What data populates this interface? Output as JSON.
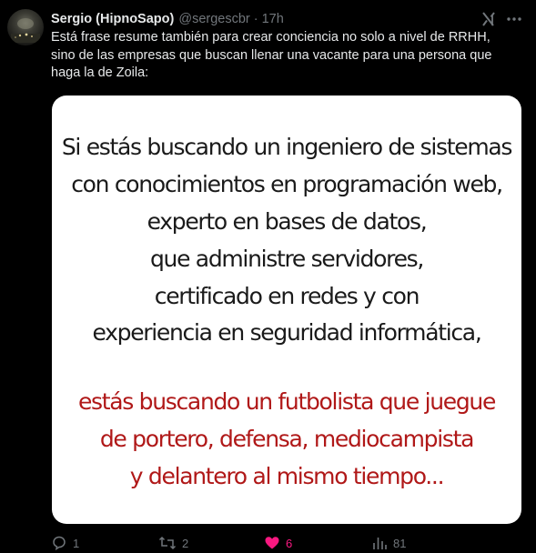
{
  "tweet": {
    "author_name": "Sergio (HipnoSapo)",
    "author_handle": "@sergescbr",
    "separator": "·",
    "timestamp": "17h",
    "text_lines": [
      "Está frase resume también para crear conciencia no solo a nivel de RRHH,",
      "sino de las empresas que buscan llenar una vacante para una persona que",
      "haga la de Zoila:"
    ],
    "image_text": {
      "black_lines": [
        "Si estás buscando un ingeniero de sistemas",
        "con conocimientos en programación web,",
        "experto en bases de datos,",
        "que administre servidores,",
        "certificado en redes y con",
        "experiencia en seguridad informática,"
      ],
      "red_lines": [
        "estás buscando un futbolista que juegue",
        "de portero, defensa, mediocampista",
        "y delantero al mismo tiempo..."
      ]
    },
    "actions": {
      "reply_count": "1",
      "retweet_count": "2",
      "like_count": "6",
      "views_count": "81"
    }
  },
  "icons": {
    "grok": "grok-icon",
    "more": "more-icon",
    "reply": "reply-icon",
    "retweet": "retweet-icon",
    "like": "heart-icon",
    "views": "views-icon"
  },
  "colors": {
    "background": "#000000",
    "text": "#e7e9ea",
    "muted": "#71767b",
    "image_black_text": "#1a1a1a",
    "image_red_text": "#b01818",
    "like": "#f91880"
  }
}
